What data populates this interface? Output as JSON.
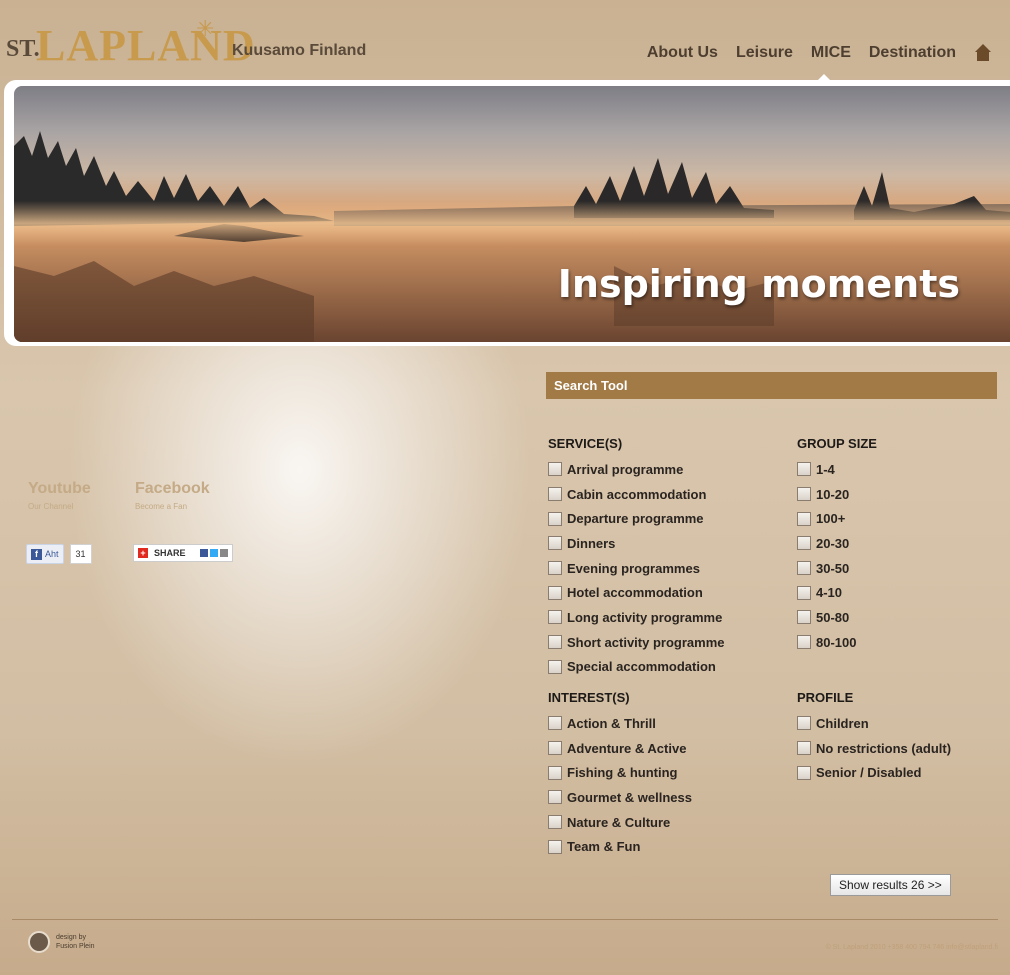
{
  "header": {
    "logo_st": "ST.",
    "logo_main": "LAPLAND",
    "logo_sub": "Kuusamo Finland",
    "nav": [
      "About Us",
      "Leisure",
      "MICE",
      "Destination"
    ]
  },
  "banner": {
    "text": "Inspiring moments"
  },
  "social": {
    "youtube_title": "Youtube",
    "youtube_sub": "Our Channel",
    "facebook_title": "Facebook",
    "facebook_sub": "Become a Fan",
    "like_label": "Aht",
    "like_count": "31",
    "share_label": "SHARE"
  },
  "search": {
    "title": "Search Tool",
    "services_title": "SERVICE(S)",
    "services": [
      "Arrival programme",
      "Cabin accommodation",
      "Departure programme",
      "Dinners",
      "Evening programmes",
      "Hotel accommodation",
      "Long activity programme",
      "Short activity programme",
      "Special accommodation"
    ],
    "group_title": "GROUP SIZE",
    "group_sizes": [
      "1-4",
      "10-20",
      "100+",
      "20-30",
      "30-50",
      "4-10",
      "50-80",
      "80-100"
    ],
    "interests_title": "INTEREST(S)",
    "interests": [
      "Action & Thrill",
      "Adventure & Active",
      "Fishing & hunting",
      "Gourmet & wellness",
      "Nature & Culture",
      "Team & Fun"
    ],
    "profile_title": "PROFILE",
    "profiles": [
      "Children",
      "No restrictions (adult)",
      "Senior / Disabled"
    ],
    "button": "Show results 26 >>"
  },
  "footer": {
    "design_line1": "design by",
    "design_line2": "Fusion Plein",
    "copyright": "© St. Lapland 2010    +358 400 794 746    info@stlapland.fi"
  }
}
